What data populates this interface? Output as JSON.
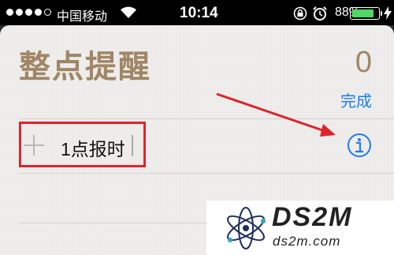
{
  "status_bar": {
    "carrier": "中国移动",
    "time": "10:14",
    "battery_percent": "88%",
    "battery_level": 0.88,
    "signal_bars": 4,
    "signal_max": 5,
    "icons": [
      "signal-dots-icon",
      "wifi-icon",
      "rotation-lock-icon",
      "alarm-icon",
      "battery-icon",
      "charging-bolt-icon"
    ]
  },
  "list": {
    "title": "整点提醒",
    "count": "0",
    "done_label": "完成"
  },
  "reminder": {
    "text": "1点报时"
  },
  "colors": {
    "title": "#a08665",
    "accent": "#1b7cf2",
    "annotation": "#e0232a",
    "battery": "#4cd964"
  },
  "watermark": {
    "title": "DS2M",
    "url": "ds2m.com"
  }
}
